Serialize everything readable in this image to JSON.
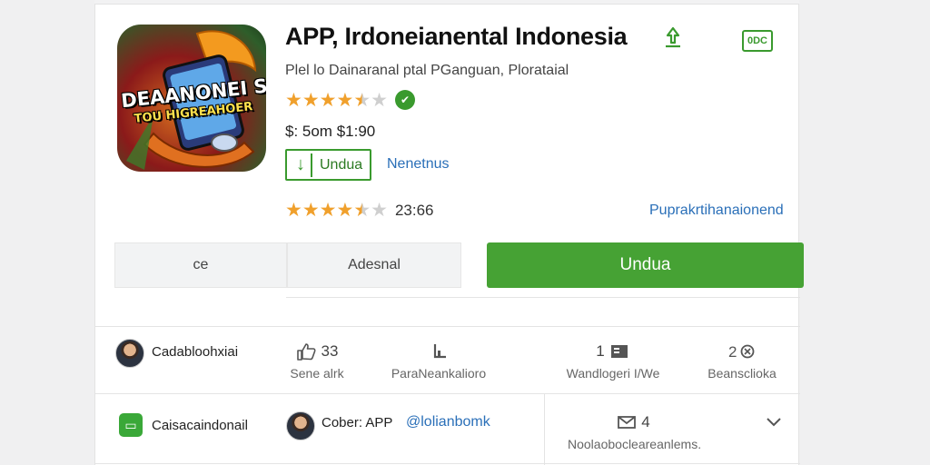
{
  "app": {
    "title": "APP, Irdoneianental Indonesia",
    "badge": "0DC",
    "subtitle": "Plel lo Dainaranal ptal PGanguan, Plorataial",
    "price": "$: 5om   $1:90",
    "download_small_label": "Undua",
    "secondary_link": "Nenetnus",
    "rating_value": "23:66",
    "right_link": "Puprakrtihanaionend",
    "icon_text_line1": "DEAANONEI SAN",
    "icon_text_line2": "TOU HIGREAHOER"
  },
  "buttons": {
    "left_label": "ce",
    "middle_label": "Adesnal",
    "primary_label": "Undua"
  },
  "row1": {
    "user_label": "Cadabloohxiai",
    "stats": [
      {
        "value": "33",
        "label": "Sene alrk",
        "icon": "thumb-up-icon"
      },
      {
        "value": "",
        "label": "ParaNeankalioro",
        "icon": "chart-icon"
      },
      {
        "value": "1",
        "label": "Wandlogeri I/We",
        "icon": "flag-icon"
      },
      {
        "value": "",
        "label": "Beansclioka",
        "icon": "refresh-icon"
      }
    ]
  },
  "row2": {
    "chat_label": "Caisacaindonail",
    "author_label": "Cober: APP",
    "handle": "@lolianbomk",
    "mail_count": "4",
    "mail_label": "Noolaobocleareanlems."
  },
  "colors": {
    "accent_green": "#46a234",
    "link_blue": "#2a6fb8",
    "star_orange": "#f0a02c"
  }
}
